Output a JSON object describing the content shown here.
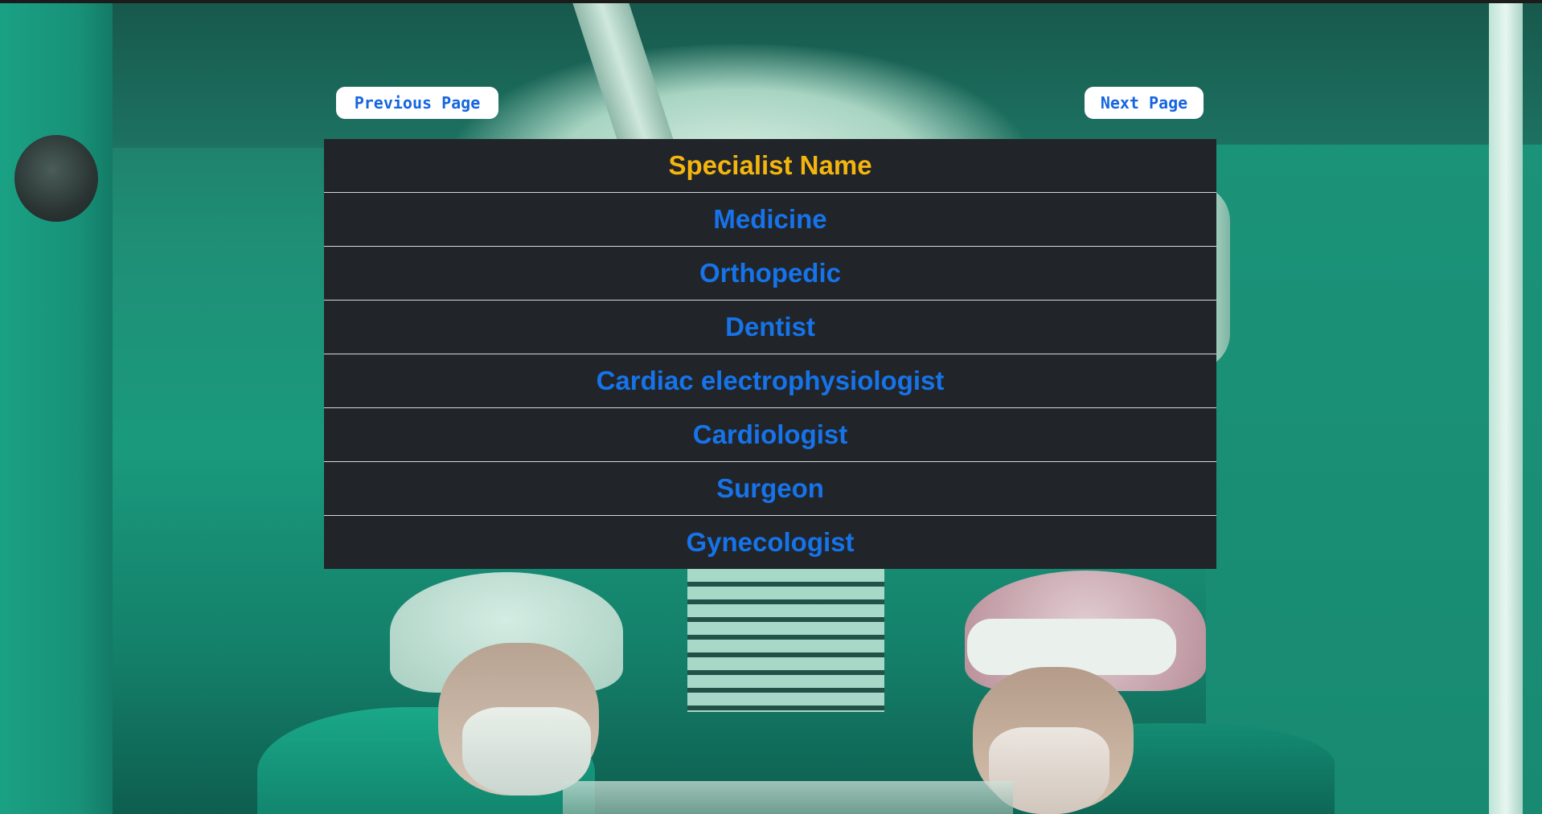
{
  "navigation": {
    "previous_label": "Previous Page",
    "next_label": "Next Page"
  },
  "table": {
    "header": "Specialist Name",
    "rows": [
      "Medicine",
      "Orthopedic",
      "Dentist",
      "Cardiac electrophysiologist",
      "Cardiologist",
      "Surgeon",
      "Gynecologist"
    ]
  },
  "colors": {
    "table_background": "#212529",
    "header_text": "#f5b50f",
    "row_text": "#1673ea",
    "button_background": "#ffffff",
    "button_text": "#1565e0",
    "page_background": "#1b8a72"
  }
}
